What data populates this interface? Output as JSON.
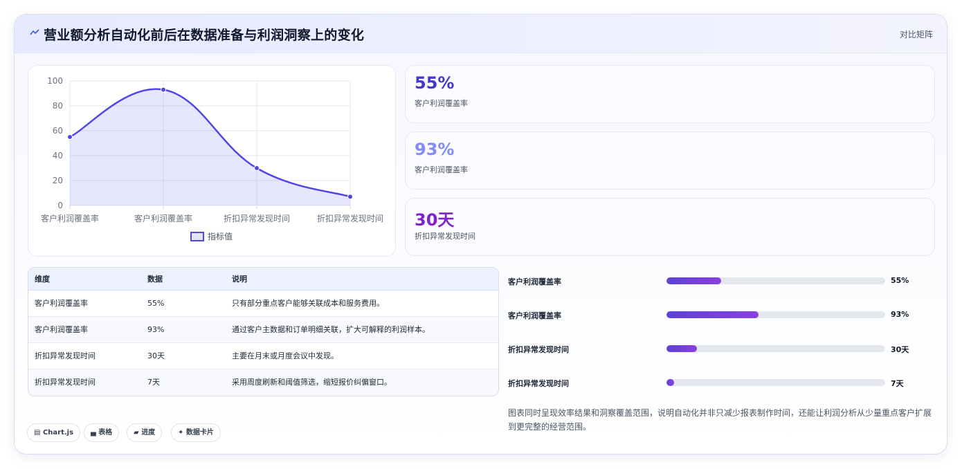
{
  "header": {
    "icon": "zigzag-line-icon",
    "title": "营业额分析自动化前后在数据准备与利润洞察上的变化",
    "right_label": "对比矩阵"
  },
  "chart_data": {
    "type": "line",
    "categories": [
      "客户利润覆盖率",
      "客户利润覆盖率",
      "折扣异常发现时间",
      "折扣异常发现时间"
    ],
    "series": [
      {
        "name": "指标值",
        "values": [
          55,
          93,
          30,
          7
        ],
        "color": "#4f46e5",
        "fill": "rgba(99,102,241,0.16)"
      }
    ],
    "ylim": [
      0,
      100
    ],
    "yticks": [
      0,
      20,
      40,
      60,
      80,
      100
    ],
    "grid": true,
    "smooth": true,
    "legend": "bottom"
  },
  "stats": [
    {
      "value": "55%",
      "label": "客户利润覆盖率",
      "color": "#4338ca"
    },
    {
      "value": "93%",
      "label": "客户利润覆盖率",
      "color": "#818cf8"
    },
    {
      "value": "30天",
      "label": "折扣异常发现时间",
      "color": "#7e22ce"
    }
  ],
  "table": {
    "headers": [
      "维度",
      "数据",
      "说明"
    ],
    "rows": [
      [
        "客户利润覆盖率",
        "55%",
        "只有部分重点客户能够关联成本和服务费用。"
      ],
      [
        "客户利润覆盖率",
        "93%",
        "通过客户主数据和订单明细关联，扩大可解释的利润样本。"
      ],
      [
        "折扣异常发现时间",
        "30天",
        "主要在月末或月度会议中发现。"
      ],
      [
        "折扣异常发现时间",
        "7天",
        "采用周度刷新和阈值筛选，缩短报价纠偏窗口。"
      ]
    ]
  },
  "progress": [
    {
      "label": "客户利润覆盖率",
      "value": "55%",
      "fraction": 0.25
    },
    {
      "label": "客户利润覆盖率",
      "value": "93%",
      "fraction": 0.42
    },
    {
      "label": "折扣异常发现时间",
      "value": "30天",
      "fraction": 0.14
    },
    {
      "label": "折扣异常发现时间",
      "value": "7天",
      "fraction": 0.03
    }
  ],
  "note": "图表同时呈现效率结果和洞察覆盖范围，说明自动化并非只减少报表制作时间，还能让利润分析从少量重点客户扩展到更完整的经营范围。",
  "tags": [
    {
      "icon": "chart-icon",
      "glyph": "▤",
      "label": "Chart.js"
    },
    {
      "icon": "table-icon",
      "glyph": "▄",
      "label": "表格"
    },
    {
      "icon": "progress-icon",
      "glyph": "▰",
      "label": "进度"
    },
    {
      "icon": "sparkle-icon",
      "glyph": "✦",
      "label": "数据卡片"
    }
  ]
}
